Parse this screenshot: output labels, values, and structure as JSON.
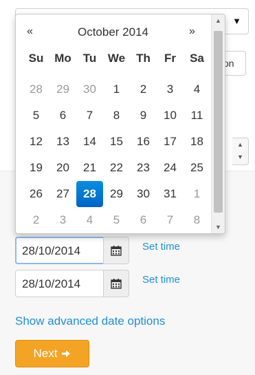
{
  "background": {
    "button_partial_label": "on"
  },
  "datepicker": {
    "prev_label": "«",
    "next_label": "»",
    "month_label": "October 2014",
    "weekdays": [
      "Su",
      "Mo",
      "Tu",
      "We",
      "Th",
      "Fr",
      "Sa"
    ],
    "weeks": [
      [
        {
          "d": "28",
          "muted": true
        },
        {
          "d": "29",
          "muted": true
        },
        {
          "d": "30",
          "muted": true
        },
        {
          "d": "1"
        },
        {
          "d": "2"
        },
        {
          "d": "3"
        },
        {
          "d": "4"
        }
      ],
      [
        {
          "d": "5"
        },
        {
          "d": "6"
        },
        {
          "d": "7"
        },
        {
          "d": "8"
        },
        {
          "d": "9"
        },
        {
          "d": "10"
        },
        {
          "d": "11"
        }
      ],
      [
        {
          "d": "12"
        },
        {
          "d": "13"
        },
        {
          "d": "14"
        },
        {
          "d": "15"
        },
        {
          "d": "16"
        },
        {
          "d": "17"
        },
        {
          "d": "18"
        }
      ],
      [
        {
          "d": "19"
        },
        {
          "d": "20"
        },
        {
          "d": "21"
        },
        {
          "d": "22"
        },
        {
          "d": "23"
        },
        {
          "d": "24"
        },
        {
          "d": "25"
        }
      ],
      [
        {
          "d": "26"
        },
        {
          "d": "27"
        },
        {
          "d": "28",
          "selected": true
        },
        {
          "d": "29"
        },
        {
          "d": "30"
        },
        {
          "d": "31"
        },
        {
          "d": "1",
          "muted": true
        }
      ],
      [
        {
          "d": "2",
          "muted": true
        },
        {
          "d": "3",
          "muted": true
        },
        {
          "d": "4",
          "muted": true
        },
        {
          "d": "5",
          "muted": true
        },
        {
          "d": "6",
          "muted": true
        },
        {
          "d": "7",
          "muted": true
        },
        {
          "d": "8",
          "muted": true
        }
      ]
    ],
    "selected_color": "#0a7ad6"
  },
  "start_date": {
    "value": "28/10/2014",
    "set_time_label": "Set time"
  },
  "end_date": {
    "value": "28/10/2014",
    "set_time_label": "Set time"
  },
  "advanced_link": "Show advanced date options",
  "next_button": {
    "label": "Next",
    "color": "#f4a425",
    "icon": "arrow-right-icon"
  },
  "colors": {
    "link": "#1f8fd8",
    "accent": "#f4a425"
  }
}
